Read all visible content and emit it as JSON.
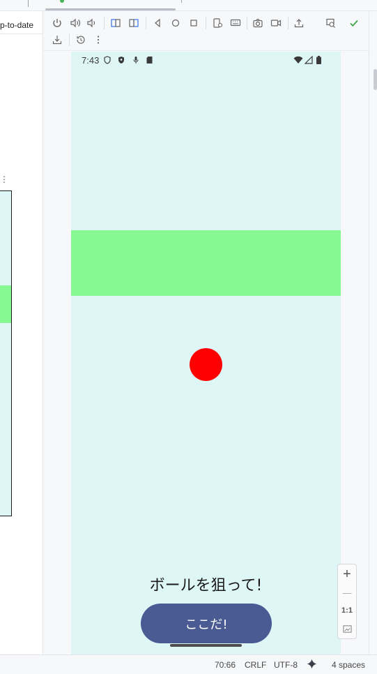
{
  "left_panel": {
    "status_text": "p-to-date"
  },
  "phone": {
    "status_time": "7:43",
    "hint_text": "ボールを狙って!",
    "button_label": "ここだ!"
  },
  "zoom": {
    "zoom_in": "+",
    "zoom_out": "—",
    "actual_size": "1:1"
  },
  "statusbar": {
    "position": "70:66",
    "line_ending": "CRLF",
    "encoding": "UTF-8",
    "indent": "4 spaces"
  },
  "colors": {
    "phone_bg": "#dff6f7",
    "green_band": "#88f992",
    "ball": "#ff0000",
    "button": "#4a5a93",
    "checkmark": "#3fa64a",
    "accent_icon": "#3574f0"
  },
  "toolbar_icons": [
    "power-icon",
    "volume-up-icon",
    "volume-down-icon",
    "rotate-left-icon",
    "rotate-right-icon",
    "back-icon",
    "home-icon",
    "overview-icon",
    "device-settings-icon",
    "keyboard-icon",
    "camera-icon",
    "screen-record-icon",
    "upload-icon",
    "mirror-window-icon",
    "checkmark-icon",
    "download-icon",
    "history-icon",
    "more-icon"
  ]
}
